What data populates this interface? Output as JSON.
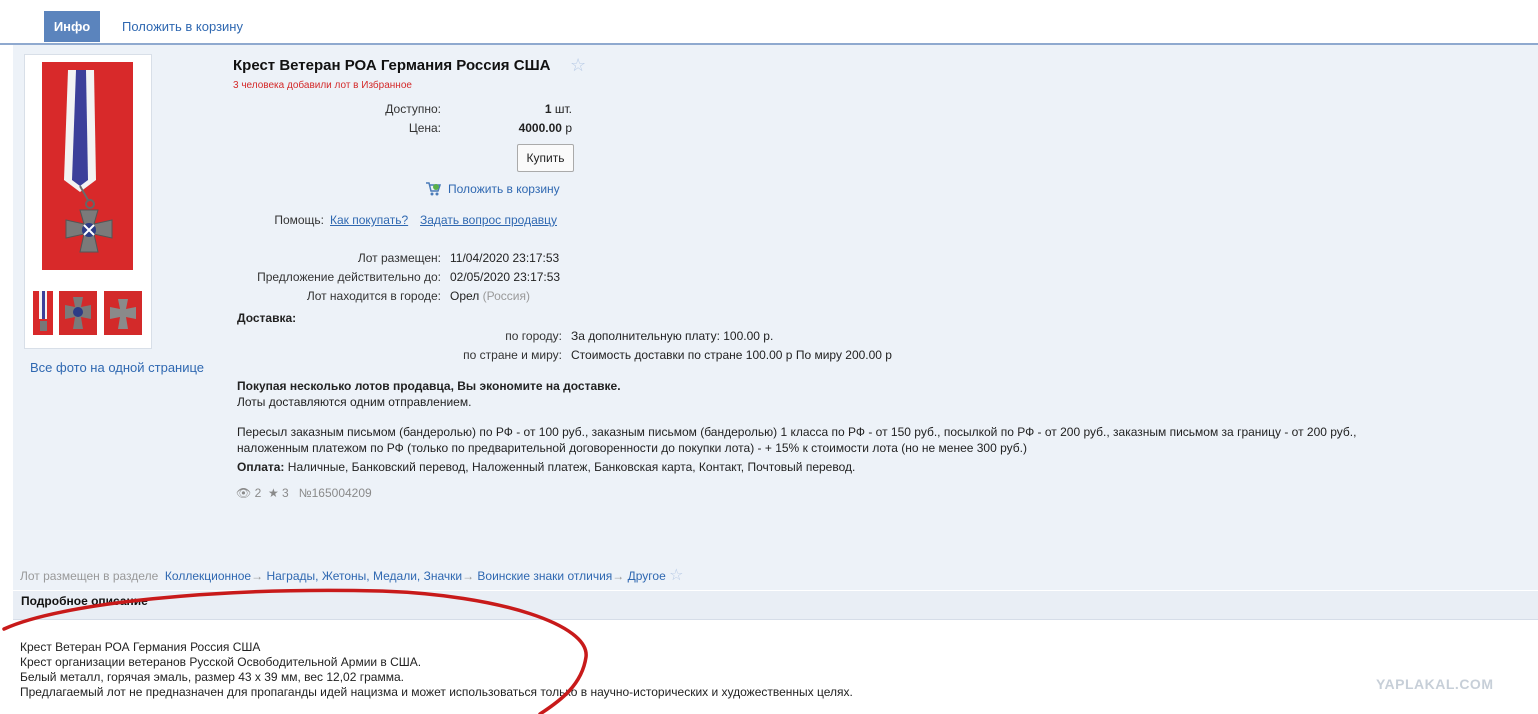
{
  "tabs": {
    "info": "Инфо",
    "cart": "Положить в корзину"
  },
  "lot": {
    "title": "Крест Ветеран РОА Германия Россия США",
    "favorites_note": "3 человека добавили лот в Избранное",
    "available_label": "Доступно:",
    "available_value": "1",
    "available_unit": "шт.",
    "price_label": "Цена:",
    "price_value": "4000.00",
    "price_unit": "р",
    "buy_button": "Купить",
    "add_to_cart": "Положить в корзину",
    "help_label": "Помощь:",
    "help_link_how": "Как покупать?",
    "help_link_ask": "Задать вопрос продавцу",
    "placed_label": "Лот размещен:",
    "placed_value": "11/04/2020 23:17:53",
    "valid_label": "Предложение действительно до:",
    "valid_value": "02/05/2020 23:17:53",
    "city_label": "Лот находится в городе:",
    "city_value": "Орел",
    "city_country": "(Россия)"
  },
  "delivery": {
    "heading": "Доставка:",
    "city_label": "по городу:",
    "city_value": "За дополнительную плату: 100.00 р.",
    "country_label": "по стране и миру:",
    "country_value": "Стоимость доставки по стране 100.00 р По миру 200.00 р",
    "save_bold": "Покупая несколько лотов продавца, Вы экономите на доставке.",
    "save_note": "Лоты доставляются одним отправлением.",
    "shipping_line1": "Пересыл заказным письмом (бандеролью) по РФ - от 100 руб., заказным письмом (бандеролью) 1 класса по РФ - от 150 руб., посылкой по РФ - от 200 руб., заказным письмом за границу - от 200 руб.,",
    "shipping_line2": "наложенным платежом по РФ (только по предварительной договоренности до покупки лота) - + 15% к стоимости лота (но не менее 300 руб.)",
    "payment_label": "Оплата:",
    "payment_value": "Наличные, Банковский перевод, Наложенный платеж, Банковская карта, Контакт, Почтовый перевод."
  },
  "stats": {
    "views": "2",
    "stars": "3",
    "lot_number": "№165004209"
  },
  "gallery": {
    "all_photos": "Все фото на одной странице"
  },
  "section": {
    "label": "Лот размещен в разделе",
    "crumb1": "Коллекционное",
    "crumb2": "Награды, Жетоны, Медали, Значки",
    "crumb3": "Воинские знаки отличия",
    "crumb4": "Другое",
    "arrow": "→"
  },
  "description": {
    "heading": "Подробное описание",
    "lines": [
      "Крест Ветеран РОА Германия Россия США",
      "Крест организации ветеранов Русской Освободительной Армии в США.",
      "Белый металл, горячая эмаль, размер 43 х 39 мм, вес 12,02 грамма.",
      "Предлагаемый лот не предназначен для пропаганды идей нацизма и может использоваться только в научно-исторических и художественных целях."
    ]
  },
  "watermark": "YAPLAKAL.COM",
  "colors": {
    "accent": "#5b84bd",
    "link": "#2f68b1",
    "panel": "#edf2f8",
    "alert": "#d42a2a",
    "annotation": "#c81a1a"
  }
}
